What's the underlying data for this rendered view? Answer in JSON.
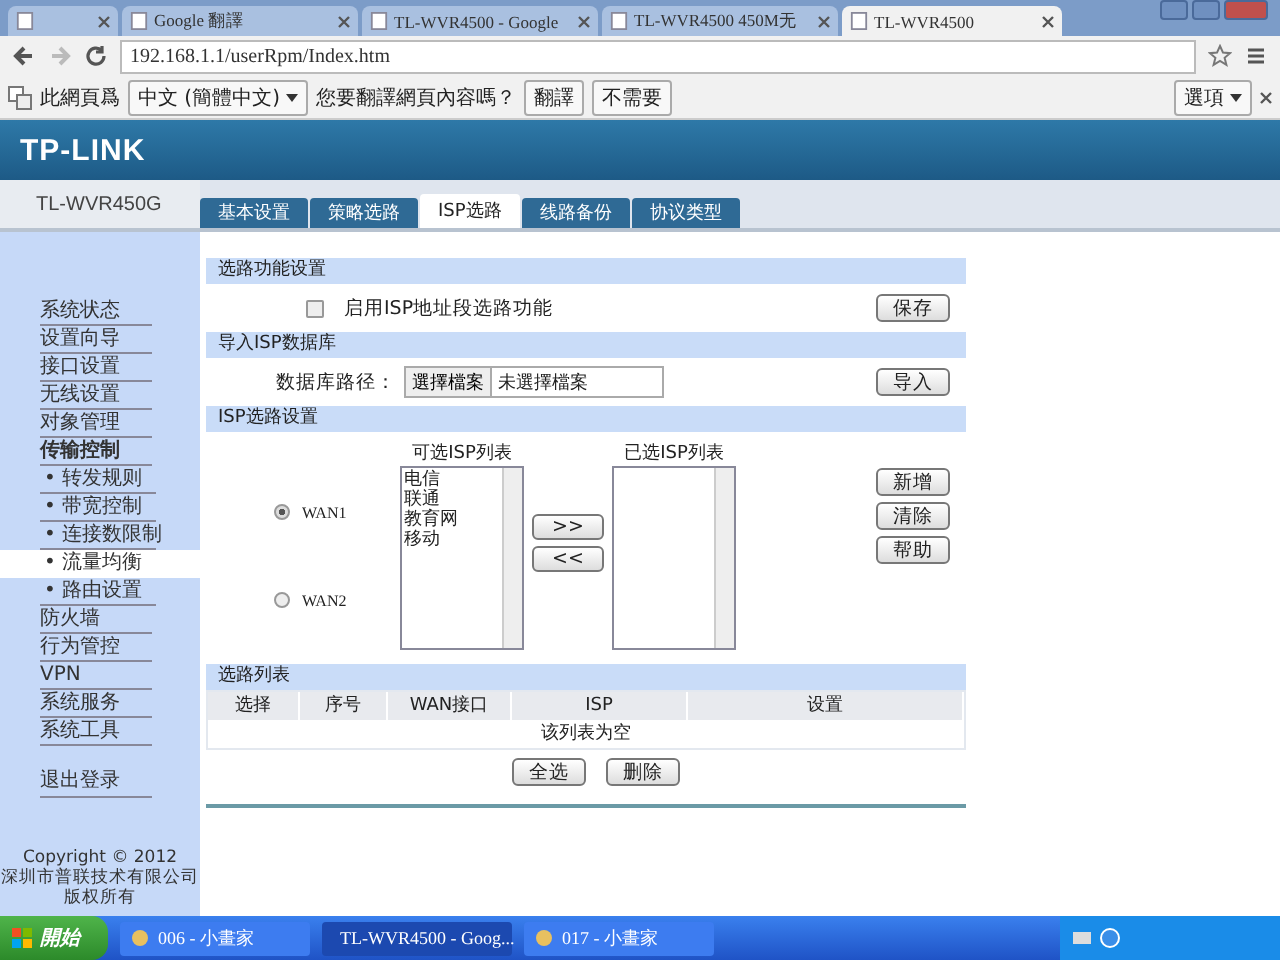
{
  "browser": {
    "tabs": [
      {
        "selected": false
      },
      {
        "title": "Google 翻譯",
        "selected": false
      },
      {
        "title": "TL-WVR4500 - Google",
        "selected": false
      },
      {
        "title": "TL-WVR4500 450M无",
        "selected": false
      },
      {
        "title": "TL-WVR4500",
        "selected": true
      }
    ],
    "address": "192.168.1.1/userRpm/Index.htm",
    "translate_bar": {
      "label": "此網頁爲",
      "language": "中文 (簡體中文)",
      "question": "您要翻譯網頁內容嗎？",
      "buttons": [
        "翻譯",
        "不需要"
      ],
      "options": "選項"
    }
  },
  "header": {
    "logo": "TP-LINK",
    "model": "TL-WVR450G"
  },
  "nav_tabs": [
    {
      "label": "基本设置",
      "selected": false
    },
    {
      "label": "策略选路",
      "selected": false
    },
    {
      "label": "ISP选路",
      "selected": true
    },
    {
      "label": "线路备份",
      "selected": false
    },
    {
      "label": "协议类型",
      "selected": false
    }
  ],
  "sidebar": {
    "items": [
      {
        "label": "系统状态",
        "kind": "main",
        "selected": false
      },
      {
        "label": "设置向导",
        "kind": "main",
        "selected": false
      },
      {
        "label": "接口设置",
        "kind": "main",
        "selected": false
      },
      {
        "label": "无线设置",
        "kind": "main",
        "selected": false
      },
      {
        "label": "对象管理",
        "kind": "main",
        "selected": false
      },
      {
        "label": "传输控制",
        "kind": "group",
        "selected": false
      },
      {
        "label": "• 转发规则",
        "kind": "sub",
        "selected": false
      },
      {
        "label": "• 带宽控制",
        "kind": "sub",
        "selected": false
      },
      {
        "label": "• 连接数限制",
        "kind": "sub",
        "selected": false
      },
      {
        "label": "• 流量均衡",
        "kind": "sub",
        "selected": true
      },
      {
        "label": "• 路由设置",
        "kind": "sub",
        "selected": false
      },
      {
        "label": "防火墙",
        "kind": "main",
        "selected": false
      },
      {
        "label": "行为管控",
        "kind": "main",
        "selected": false
      },
      {
        "label": "VPN",
        "kind": "main",
        "selected": false
      },
      {
        "label": "系统服务",
        "kind": "main",
        "selected": false
      },
      {
        "label": "系统工具",
        "kind": "main",
        "selected": false
      }
    ],
    "logout": "退出登录",
    "copyright": [
      "Copyright © 2012",
      "深圳市普联技术有限公司",
      "版权所有"
    ]
  },
  "route_function": {
    "title": "选路功能设置",
    "checkbox": {
      "label": "启用ISP地址段选路功能",
      "checked": false
    },
    "save": "保存"
  },
  "import_db": {
    "title": "导入ISP数据库",
    "path_label": "数据库路径：",
    "choose": "選擇檔案",
    "file": "未選擇檔案",
    "import": "导入"
  },
  "isp_settings": {
    "title": "ISP选路设置",
    "wans": [
      {
        "label": "WAN1",
        "selected": true
      },
      {
        "label": "WAN2",
        "selected": false
      }
    ],
    "available_label": "可选ISP列表",
    "available": [
      "电信",
      "联通",
      "教育网",
      "移动"
    ],
    "add_arrow": ">>",
    "remove_arrow": "<<",
    "selected_label": "已选ISP列表",
    "buttons": [
      "新增",
      "清除",
      "帮助"
    ]
  },
  "route_list": {
    "title": "选路列表",
    "columns": [
      "选择",
      "序号",
      "WAN接口",
      "ISP",
      "设置"
    ],
    "empty": "该列表为空",
    "buttons": [
      "全选",
      "删除"
    ]
  },
  "taskbar": {
    "start": "開始",
    "tasks": [
      {
        "label": "006 - 小畫家",
        "selected": false
      },
      {
        "label": "TL-WVR4500 - Goog...",
        "selected": true
      },
      {
        "label": "017 - 小畫家",
        "selected": false
      }
    ]
  }
}
